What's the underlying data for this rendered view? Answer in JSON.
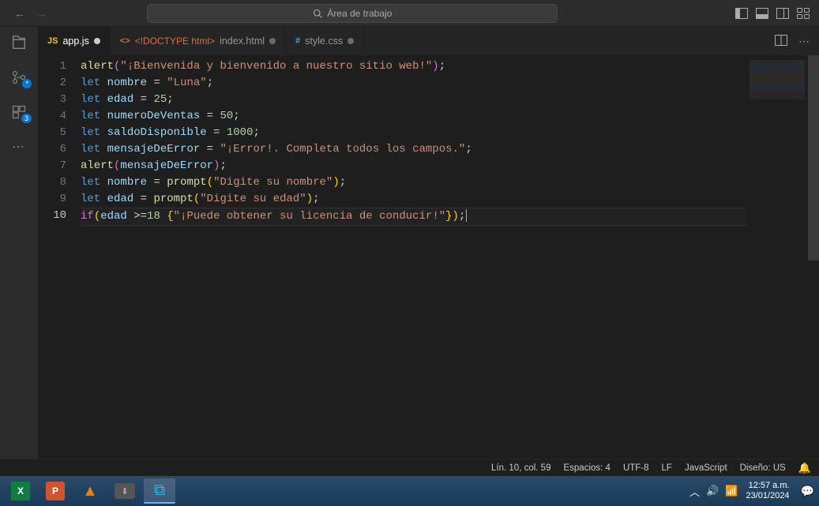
{
  "titlebar": {
    "search_placeholder": "Área de trabajo"
  },
  "tabs": [
    {
      "icon": "JS",
      "label": "app.js",
      "active": true,
      "dirty": true
    },
    {
      "icon": "<>",
      "prefix": "<!DOCTYPE html>",
      "label": "index.html",
      "active": false,
      "dirty": true
    },
    {
      "icon": "#",
      "label": "style.css",
      "active": false,
      "dirty": true
    }
  ],
  "code": {
    "lines": [
      [
        [
          "fn",
          "alert"
        ],
        [
          "p",
          "("
        ],
        [
          "s",
          "\"¡Bienvenida y bienvenido a nuestro sitio web!\""
        ],
        [
          "p",
          ")"
        ],
        [
          "op",
          ";"
        ]
      ],
      [
        [
          "kw",
          "let"
        ],
        [
          "op",
          " "
        ],
        [
          "v",
          "nombre"
        ],
        [
          "op",
          " = "
        ],
        [
          "s",
          "\"Luna\""
        ],
        [
          "op",
          ";"
        ]
      ],
      [
        [
          "kw",
          "let"
        ],
        [
          "op",
          " "
        ],
        [
          "v",
          "edad"
        ],
        [
          "op",
          " = "
        ],
        [
          "n",
          "25"
        ],
        [
          "op",
          ";"
        ]
      ],
      [
        [
          "kw",
          "let"
        ],
        [
          "op",
          " "
        ],
        [
          "v",
          "numeroDeVentas"
        ],
        [
          "op",
          " = "
        ],
        [
          "n",
          "50"
        ],
        [
          "op",
          ";"
        ]
      ],
      [
        [
          "kw",
          "let"
        ],
        [
          "op",
          " "
        ],
        [
          "v",
          "saldoDisponible"
        ],
        [
          "op",
          " = "
        ],
        [
          "n",
          "1000"
        ],
        [
          "op",
          ";"
        ]
      ],
      [
        [
          "kw",
          "let"
        ],
        [
          "op",
          " "
        ],
        [
          "v",
          "mensajeDeError"
        ],
        [
          "op",
          " = "
        ],
        [
          "s",
          "\"¡Error!. Completa todos los campos.\""
        ],
        [
          "op",
          ";"
        ]
      ],
      [
        [
          "fn",
          "alert"
        ],
        [
          "p",
          "("
        ],
        [
          "v",
          "mensajeDeError"
        ],
        [
          "p",
          ")"
        ],
        [
          "op",
          ";"
        ]
      ],
      [
        [
          "kw",
          "let"
        ],
        [
          "op",
          " "
        ],
        [
          "v",
          "nombre"
        ],
        [
          "op",
          " = "
        ],
        [
          "fn",
          "prompt"
        ],
        [
          "br",
          "("
        ],
        [
          "s",
          "\"Digite su nombre\""
        ],
        [
          "br",
          ")"
        ],
        [
          "op",
          ";"
        ]
      ],
      [
        [
          "kw",
          "let"
        ],
        [
          "op",
          " "
        ],
        [
          "v",
          "edad"
        ],
        [
          "op",
          " = "
        ],
        [
          "fn",
          "prompt"
        ],
        [
          "br",
          "("
        ],
        [
          "s",
          "\"Digite su edad\""
        ],
        [
          "br",
          ")"
        ],
        [
          "op",
          ";"
        ]
      ],
      [
        [
          "p",
          "if"
        ],
        [
          "br",
          "("
        ],
        [
          "v",
          "edad"
        ],
        [
          "op",
          " >="
        ],
        [
          "n",
          "18"
        ],
        [
          "op",
          " "
        ],
        [
          "br",
          "{"
        ],
        [
          "s",
          "\"¡Puede obtener su licencia de conducir!\""
        ],
        [
          "br",
          "}"
        ],
        [
          "br",
          ")"
        ],
        [
          "op",
          ";"
        ]
      ]
    ],
    "current_line": 10
  },
  "status": {
    "position": "Lín. 10, col. 59",
    "spaces": "Espacios: 4",
    "encoding": "UTF-8",
    "eol": "LF",
    "language": "JavaScript",
    "layout": "Diseño: US"
  },
  "taskbar": {
    "time": "12:57 a.m.",
    "date": "23/01/2024"
  }
}
